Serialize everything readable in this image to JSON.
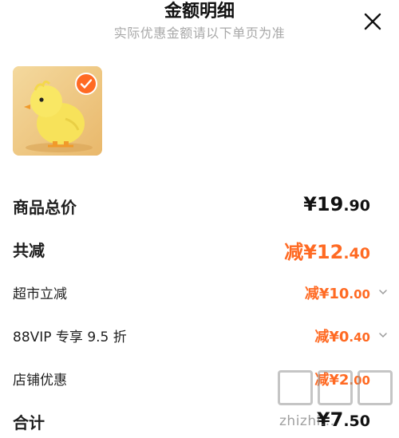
{
  "header": {
    "title": "金额明细",
    "subtitle": "实际优惠金额请以下单页为准"
  },
  "product": {
    "image_icon": "yellow-chick-toy-image",
    "selected_icon": "checkmark-icon"
  },
  "rows": {
    "total_price": {
      "label": "商品总价",
      "symbol": "¥",
      "int": "19",
      "dec": ".90"
    },
    "total_discount": {
      "label": "共减",
      "prefix": "减",
      "symbol": "¥",
      "int": "12",
      "dec": ".40"
    },
    "supermarket": {
      "label": "超市立减",
      "prefix": "减",
      "symbol": "¥",
      "int": "10",
      "dec": ".00"
    },
    "vip": {
      "label": "88VIP 专享 9.5 折",
      "prefix": "减",
      "symbol": "¥",
      "int": "0",
      "dec": ".40"
    },
    "store": {
      "label": "店铺优惠",
      "prefix": "减",
      "symbol": "¥",
      "int": "2",
      "dec": ".00"
    },
    "sum": {
      "label": "合计",
      "symbol": "¥",
      "int": "7",
      "dec": ".50"
    }
  },
  "watermark": {
    "text": "zhizhi..."
  },
  "colors": {
    "accent": "#ff6a23",
    "text": "#1f1f1f",
    "muted": "#a8a8a8"
  }
}
